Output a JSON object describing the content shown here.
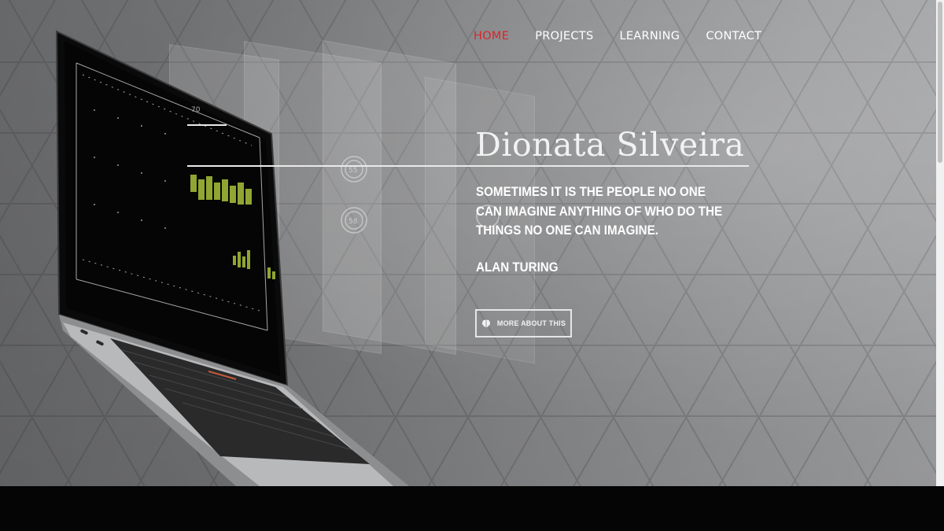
{
  "nav": {
    "items": [
      {
        "label": "HOME",
        "active": true
      },
      {
        "label": "PROJECTS",
        "active": false
      },
      {
        "label": "LEARNING",
        "active": false
      },
      {
        "label": "CONTACT",
        "active": false
      }
    ],
    "active_color": "#d9262b"
  },
  "hero": {
    "title": "Dionata Silveira",
    "quote": "SOMETIMES IT IS THE PEOPLE NO ONE CAN IMAGINE ANYTHING OF WHO DO THE THINGS NO ONE CAN IMAGINE.",
    "author": "ALAN TURING",
    "button_label": "MORE ABOUT THIS",
    "button_icon": "brain-icon"
  },
  "laptop": {
    "gauge_top": "55",
    "gauge_bottom": "58",
    "readout": "70"
  }
}
